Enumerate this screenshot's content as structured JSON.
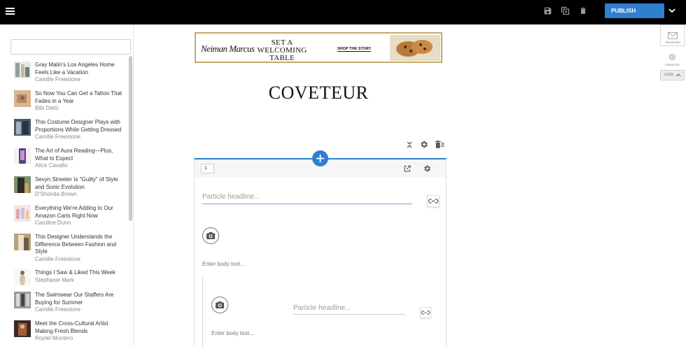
{
  "topbar": {
    "publish_label": "PUBLISH",
    "accent": "#2f7fd1"
  },
  "sidebar": {
    "search_placeholder": "",
    "articles": [
      {
        "title": "Gray Malin's Los Angeles Home Feels Like a Vacation",
        "author": "Camille Freestone"
      },
      {
        "title": "So Now You Can Get a Tattoo That Fades in a Year",
        "author": "Bibi Deitz"
      },
      {
        "title": "This Costume Designer Plays with Proportions While Getting Dressed",
        "author": "Camille Freestone"
      },
      {
        "title": "The Art of Aura Reading—Plus, What to Expect",
        "author": "Alice Cavallo"
      },
      {
        "title": "Sevyn Streeter Is \"Guilty\" of Style and Sonic Evolution",
        "author": "D'Shonda Brown"
      },
      {
        "title": "Everything We're Adding to Our Amazon Carts Right Now",
        "author": "Caroline Dunn"
      },
      {
        "title": "This Designer Understands the Difference Between Fashion and Style",
        "author": "Camille Freestone"
      },
      {
        "title": "Things I Saw & Liked This Week",
        "author": "Stephanie Mark"
      },
      {
        "title": "The Swimwear Our Staffers Are Buying for Summer",
        "author": "Camille Freestone"
      },
      {
        "title": "Meet the Cross-Cultural Artist Making Fresh Blends",
        "author": "Roytel Montero"
      }
    ]
  },
  "rightpanel": {
    "newsletter_label": "Newsletter",
    "advanced_label": "Advanced",
    "less_label": "LESS"
  },
  "ad": {
    "brand": "Neiman Marcus",
    "headline_line1": "SET A WELCOMING",
    "headline_line2": "TABLE",
    "cta": "SHOP THE STORY"
  },
  "logo": "COVETEUR",
  "editor": {
    "page_number": "1",
    "headline_placeholder": "Particle headline...",
    "body_placeholder": "Enter body text...",
    "nested_headline_placeholder": "Particle headline...",
    "nested_body_placeholder": "Enter body text..."
  }
}
